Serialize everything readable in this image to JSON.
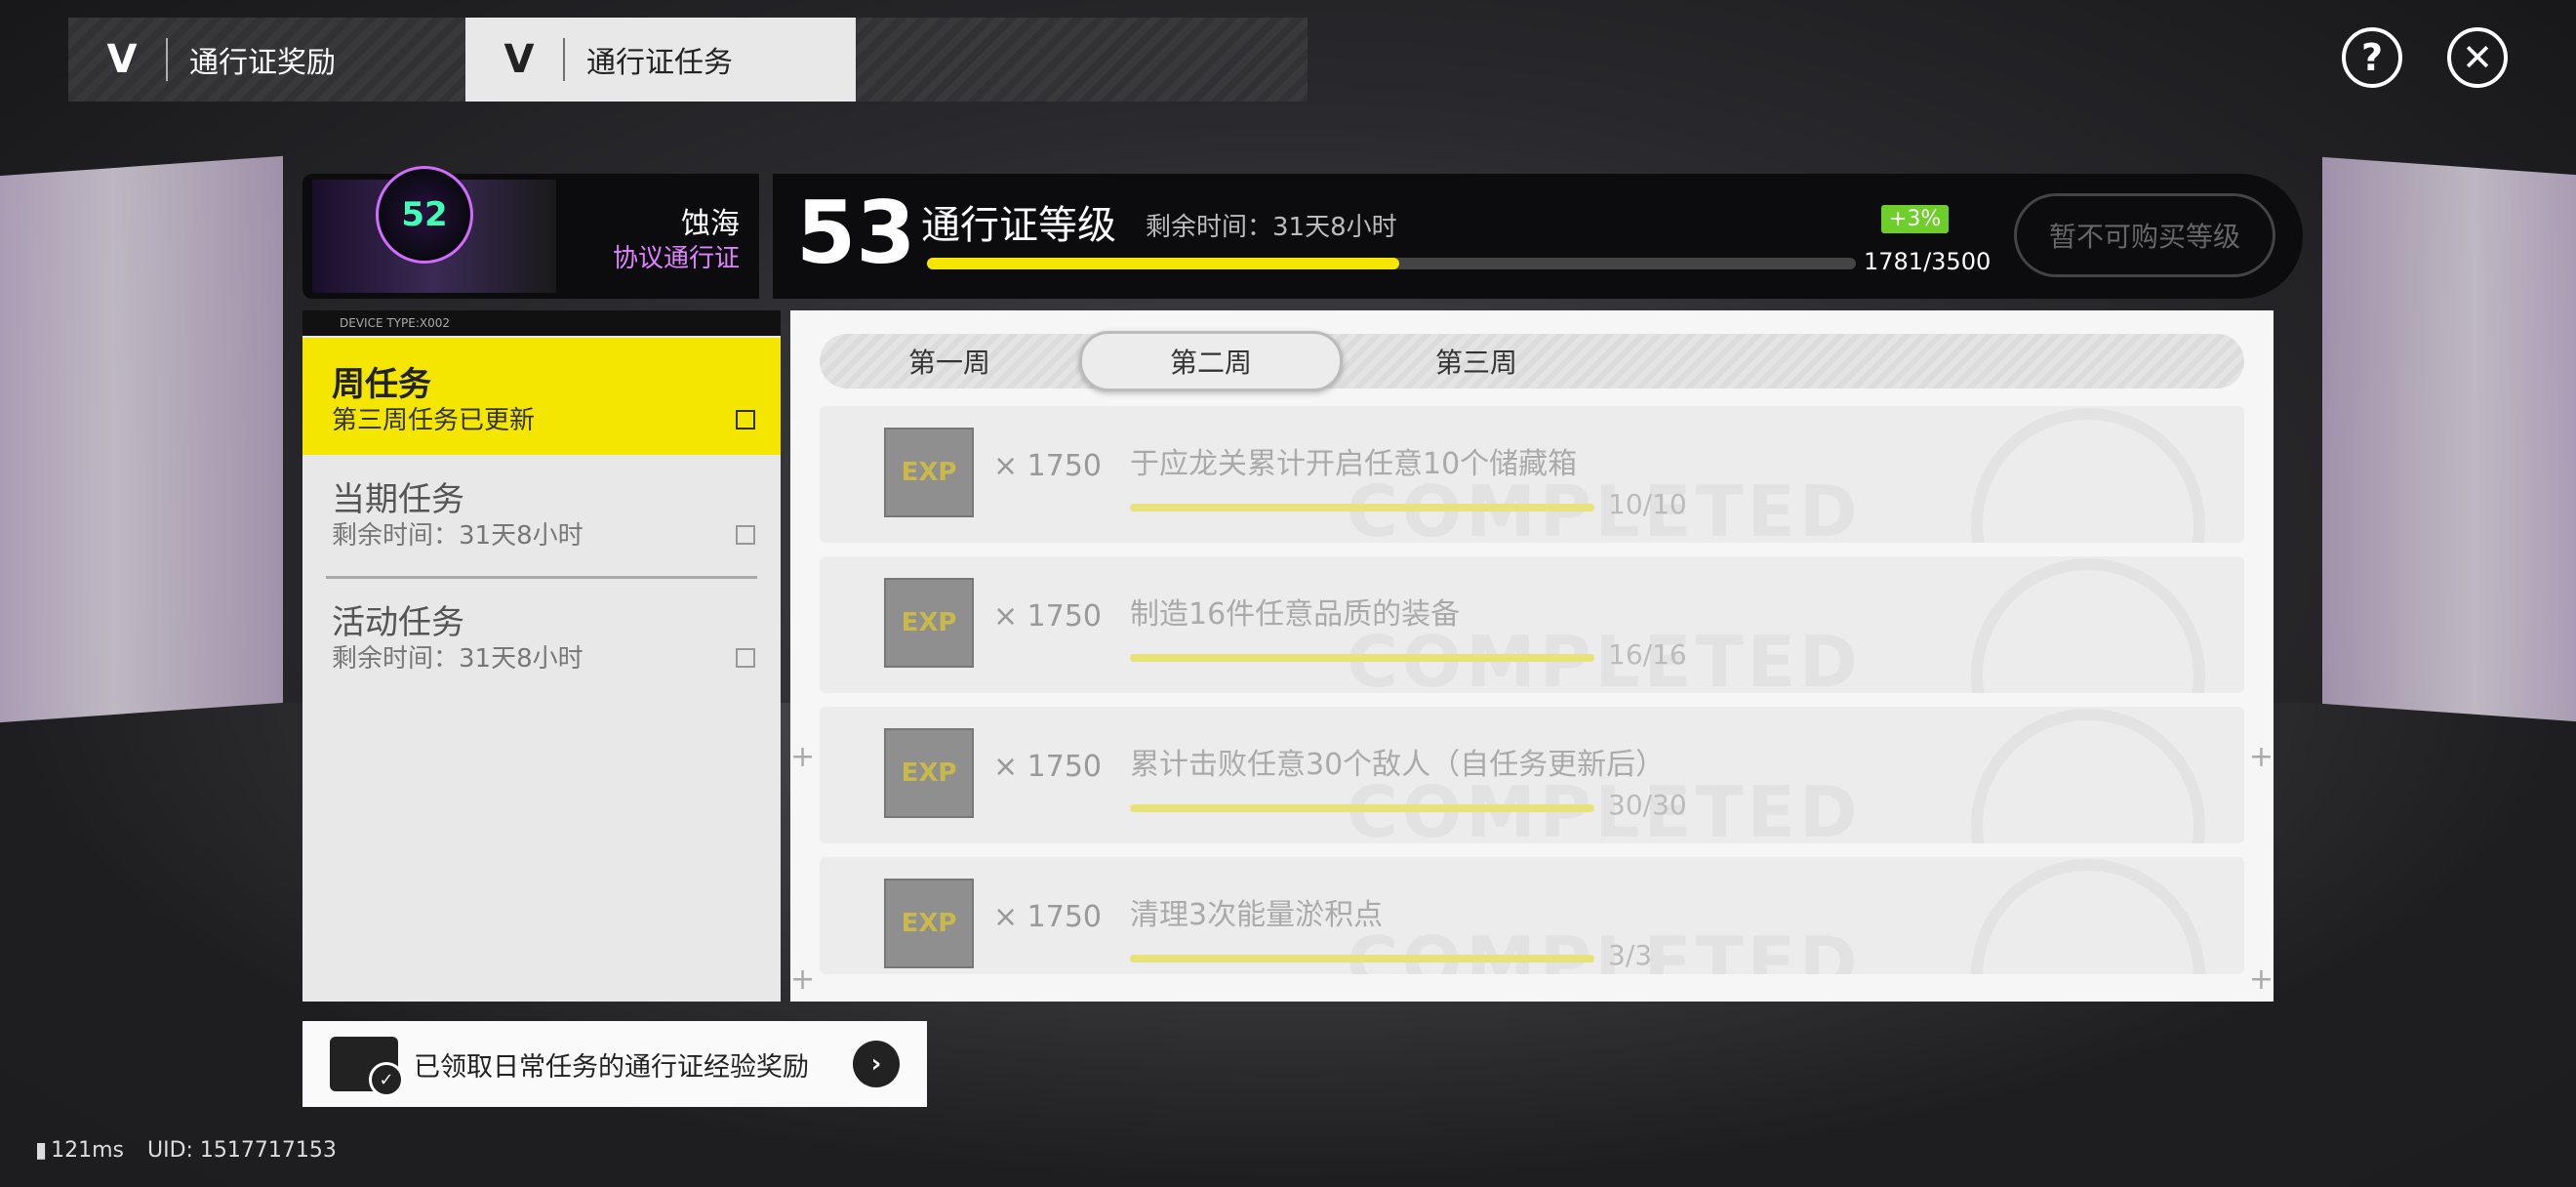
{
  "tabs": {
    "reward_label": "通行证奖励",
    "task_label": "通行证任务",
    "logo_text": "V"
  },
  "top_icons": {
    "help": "?",
    "close": "✕"
  },
  "pass": {
    "name": "蚀海",
    "subtitle": "协议通行证",
    "emblem": "52"
  },
  "level": {
    "number": "53",
    "title": "通行证等级",
    "remaining": "剩余时间：31天8小时",
    "exp_text": "1781/3500",
    "exp_fraction": 0.5089,
    "bonus": "+3%",
    "buy_label": "暂不可购买等级"
  },
  "menu": {
    "header": "DEVICE TYPE:X002",
    "items": [
      {
        "title": "周任务",
        "sub": "第三周任务已更新",
        "active": true
      },
      {
        "title": "当期任务",
        "sub": "剩余时间：31天8小时",
        "active": false
      },
      {
        "title": "活动任务",
        "sub": "剩余时间：31天8小时",
        "active": false
      }
    ]
  },
  "weeks": [
    "第一周",
    "第二周",
    "第三周"
  ],
  "tasks": [
    {
      "count": "× 1750",
      "desc": "于应龙关累计开启任意10个储藏箱",
      "progress": "10/10"
    },
    {
      "count": "× 1750",
      "desc": "制造16件任意品质的装备",
      "progress": "16/16"
    },
    {
      "count": "× 1750",
      "desc": "累计击败任意30个敌人（自任务更新后）",
      "progress": "30/30"
    },
    {
      "count": "× 1750",
      "desc": "清理3次能量淤积点",
      "progress": "3/3"
    }
  ],
  "task_reward_label": "EXP",
  "task_stamp": "COMPLETED",
  "daily": {
    "label": "已领取日常任务的通行证经验奖励"
  },
  "status": {
    "ping": "121ms",
    "uid": "UID: 1517717153"
  },
  "colors": {
    "accent": "#f5e600",
    "pass_purple": "#e080ff",
    "bonus_green": "#6fcf2a"
  }
}
